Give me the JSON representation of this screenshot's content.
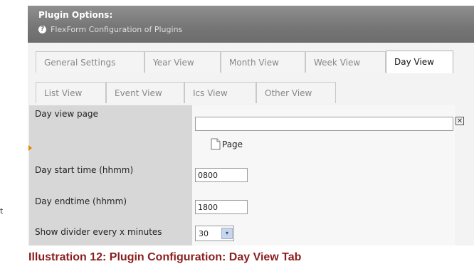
{
  "header": {
    "title": "Plugin Options:",
    "subtitle": "FlexForm Configuration of Plugins",
    "help_icon": "?"
  },
  "tabs_row1": [
    "General Settings",
    "Year View",
    "Month View",
    "Week View",
    "Day View"
  ],
  "tabs_row2": [
    "List View",
    "Event View",
    "Ics View",
    "Other View"
  ],
  "active_tab": "Day View",
  "form": {
    "day_view_page_label": "Day view page",
    "day_view_page_value": "",
    "page_link_label": "Page",
    "clear_icon": "✕",
    "day_start_label": "Day start time (hhmm)",
    "day_start_value": "0800",
    "day_end_label": "Day endtime (hhmm)",
    "day_end_value": "1800",
    "divider_label": "Show divider every x minutes",
    "divider_value": "30",
    "dropdown_icon": "▾"
  },
  "caption": "Illustration 12: Plugin Configuration: Day View Tab",
  "edge_text": "t"
}
